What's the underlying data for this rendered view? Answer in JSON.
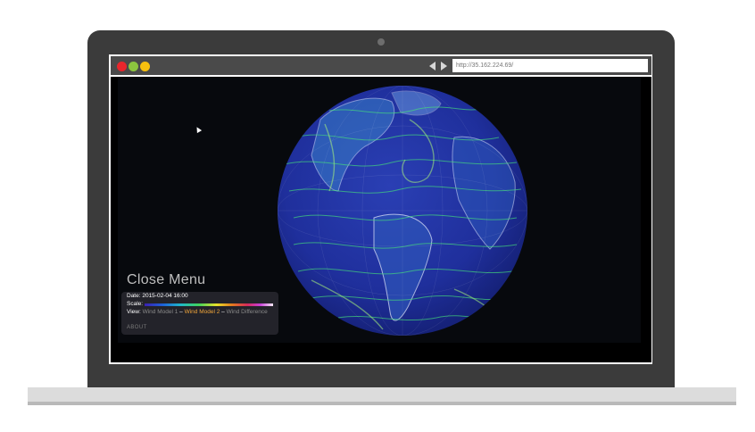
{
  "browser": {
    "window_controls": [
      "close",
      "minimize",
      "maximize"
    ],
    "url": "http://35.162.224.69/"
  },
  "menu": {
    "title": "Close Menu",
    "date_label": "Date: 2015-02-04 16:00",
    "scale_label": "Scale:",
    "view_label": "View:",
    "view_options": [
      "Wind Model 1",
      "Wind Model 2",
      "Wind Difference"
    ],
    "separator": "–",
    "about": "ABOUT"
  },
  "colors": {
    "bezel": "#3b3b3b",
    "background": "#07090d",
    "active_view": "#f0a53a",
    "ocean": "#1e2f9e",
    "wind": "#37d27a"
  },
  "icons": [
    "back-arrow-icon",
    "forward-arrow-icon",
    "cursor-icon"
  ]
}
